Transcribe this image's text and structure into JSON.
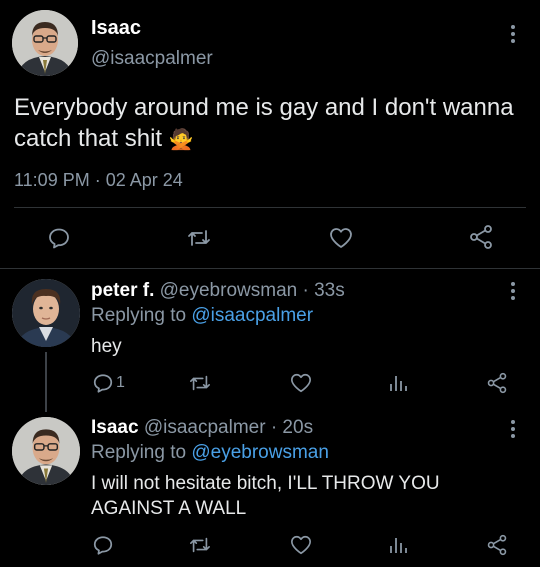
{
  "tweet": {
    "author_name": "Isaac",
    "author_handle": "@isaacpalmer",
    "text": "Everybody around me is gay and I don't wanna catch that shit",
    "emoji": "🙅",
    "timestamp": "11:09 PM · 02 Apr 24"
  },
  "replies": [
    {
      "author_name": "peter f.",
      "author_handle": "@eyebrowsman",
      "time": "· 33s",
      "replying_label": "Replying to",
      "replying_handle": "@isaacpalmer",
      "text": "hey",
      "reply_count": "1"
    },
    {
      "author_name": "Isaac",
      "author_handle": "@isaacpalmer",
      "time": "· 20s",
      "replying_label": "Replying to",
      "replying_handle": "@eyebrowsman",
      "text": "I will not hesitate bitch, I'LL THROW YOU AGAINST A WALL"
    }
  ],
  "icons": {
    "reply": "reply-icon",
    "retweet": "retweet-icon",
    "like": "heart-icon",
    "views": "views-icon",
    "share": "share-icon",
    "more": "more-vertical-icon"
  },
  "colors": {
    "background": "#000000",
    "text": "#e7e9ea",
    "muted": "#8b98a5",
    "link": "#4aa0e6",
    "divider": "#2f3336"
  }
}
